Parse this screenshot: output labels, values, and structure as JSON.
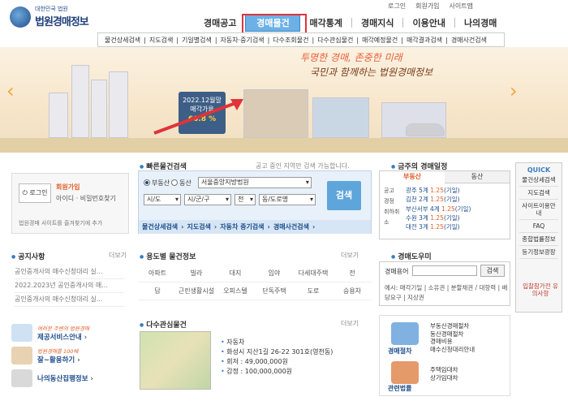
{
  "top_links": [
    "로그인",
    "회원가입",
    "사이트맵"
  ],
  "logo": {
    "sub": "대한민국 법원",
    "title": "법원경매정보"
  },
  "gnb": [
    "경매공고",
    "경매물건",
    "매각통계",
    "경매지식",
    "이용안내",
    "나의경매"
  ],
  "subnav": [
    "물건상세검색",
    "지도검색",
    "기일별검색",
    "자동차·중기검색",
    "다수조회물건",
    "다수관심물건",
    "매각예정물건",
    "매각결과검색",
    "경매사건검색"
  ],
  "hero": {
    "slogan1": "투명한 경매, 존중한 미래",
    "slogan2": "국민과 함께하는 법원경매정보",
    "sign_date": "2022.12월말",
    "sign_label": "매각가율",
    "sign_value": "66.8 %"
  },
  "login": {
    "button": "로그인",
    "join": "회원가입",
    "find": "아이디 · 비밀번호찾기",
    "fav": "법원경매 사이트를 즐겨찾기에 추가"
  },
  "quick_search": {
    "title": "빠른물건검색",
    "desc": "공고 중인 지역만 검색 가능합니다.",
    "radio1": "부동산",
    "radio2": "동산",
    "court": "서울중앙지방법원",
    "sel1": "시/도",
    "sel2": "시/군/구",
    "sel3": "전",
    "sel4": "동/도로명",
    "button": "검색",
    "links": [
      "물건상세검색",
      "지도검색",
      "자동차 중기검색",
      "경매사건검색"
    ]
  },
  "schedule": {
    "title": "금주의 경매일정",
    "tabs": [
      "부동산",
      "동산"
    ],
    "left": [
      "공고",
      "경정",
      "취하취소"
    ],
    "items": [
      {
        "court": "광주 5계",
        "date": "1.25",
        "note": "(기일)"
      },
      {
        "court": "김천 2계",
        "date": "1.25",
        "note": "(기일)"
      },
      {
        "court": "부산서부 4계",
        "date": "1.25",
        "note": "(기일)"
      },
      {
        "court": "수원 3계",
        "date": "1.25",
        "note": "(기일)"
      },
      {
        "court": "대전 3계",
        "date": "1.25",
        "note": "(기일)"
      }
    ]
  },
  "quick": {
    "title": "QUICK",
    "items": [
      "물건상세검색",
      "지도검색",
      "사이트이용안내",
      "FAQ",
      "종합법률정보",
      "등기정보광장"
    ],
    "ipchal": "입찰참가전 유의사항"
  },
  "notice": {
    "title": "공지사항",
    "more": "더보기",
    "items": [
      "공인중개사의 매수신청대리 실...",
      "2022.2023년 공인중개사의 매...",
      "공인중개사의 매수신청대리 실..."
    ]
  },
  "use_type": {
    "title": "용도별 물건정보",
    "more": "더보기",
    "items": [
      "아파트",
      "빌라",
      "대지",
      "임야",
      "다세대주택",
      "전",
      "답",
      "근린생활시설",
      "오피스텔",
      "단독주택",
      "도로",
      "승용차"
    ]
  },
  "help": {
    "title": "경매도우미",
    "label": "경매용어",
    "button": "검색",
    "keywords": "예시: 매각기일 | 소유권 | 분할채권 / 대항력 | 배당요구 | 지상권"
  },
  "banners": [
    {
      "small": "여러분 주변의 법원경매",
      "label": "제공서비스안내"
    },
    {
      "small": "법원경매를 100배",
      "label": "잘~활용하기"
    },
    {
      "small": "",
      "label": "나의동산집행정보"
    }
  ],
  "multi": {
    "title": "다수관심물건",
    "more": "더보기",
    "type": "자동차",
    "addr": "화성시 지산1길 26-22 301호(영천동)",
    "appraisal": "회저 : 49,000,000원",
    "value": "감정 : 100,000,000원"
  },
  "right_lower": {
    "a_label": "경매절차",
    "a_list": [
      "부동산경매절차",
      "동산경매절차",
      "경매비용",
      "매수신청대리안내"
    ],
    "b_label": "관련법률",
    "b_list": [
      "주택임대차",
      "상가임대차"
    ]
  }
}
